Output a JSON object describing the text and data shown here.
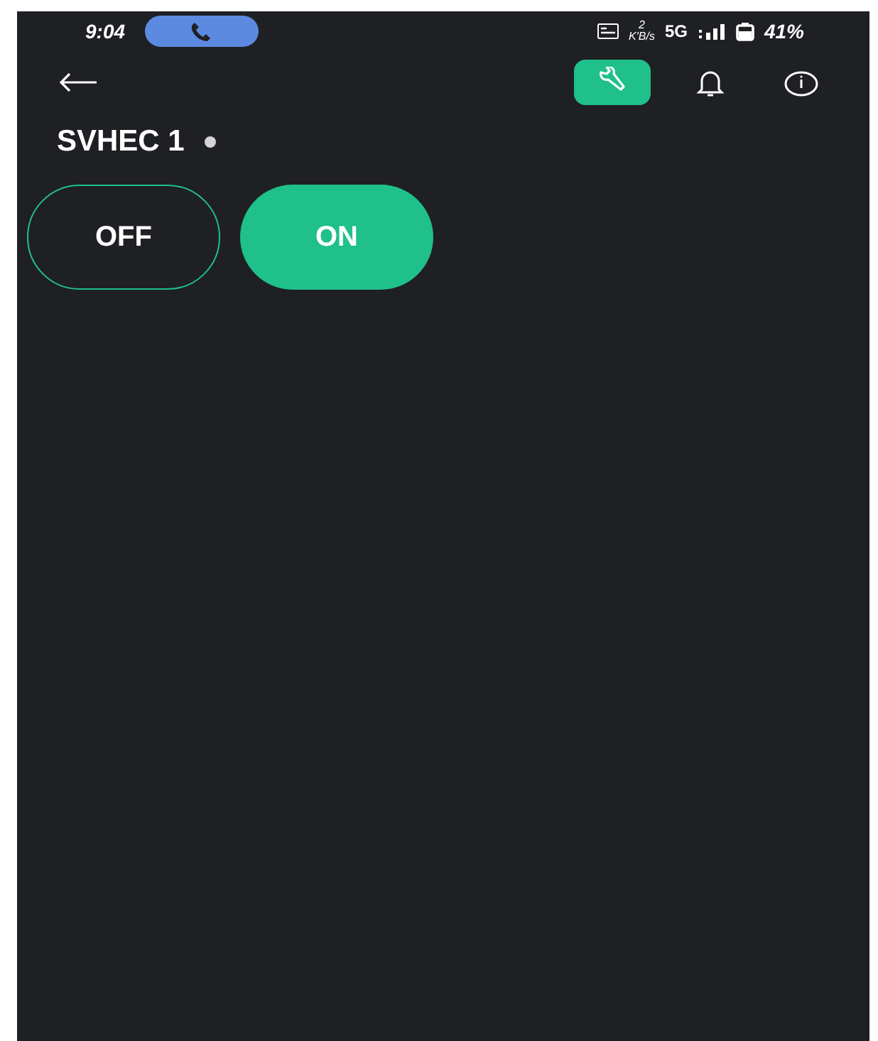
{
  "status_bar": {
    "time": "9:04",
    "call_active": true,
    "speed_value": "2",
    "speed_unit": "K'B/s",
    "network": "5G",
    "battery": "41%"
  },
  "toolbar": {
    "actions": [
      {
        "kind": "wrench",
        "selected": true
      },
      {
        "kind": "bell",
        "selected": false
      },
      {
        "kind": "info",
        "selected": false
      }
    ]
  },
  "device": {
    "name": "SVHEC 1",
    "online": false
  },
  "switches": [
    {
      "label": "OFF",
      "selected": false
    },
    {
      "label": "ON",
      "selected": true
    }
  ]
}
